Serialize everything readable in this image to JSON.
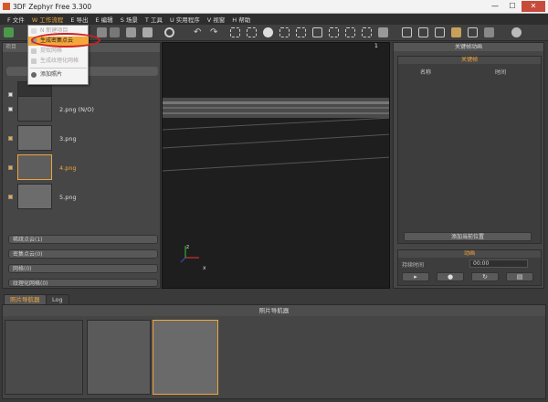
{
  "window": {
    "title": "3DF Zephyr Free 3.300",
    "min": "—",
    "max": "☐",
    "close": "✕"
  },
  "menu": [
    {
      "label": "F 文件"
    },
    {
      "label": "W 工作流程"
    },
    {
      "label": "E 导出"
    },
    {
      "label": "E 编辑"
    },
    {
      "label": "S 场景"
    },
    {
      "label": "T 工具"
    },
    {
      "label": "U 实用程序"
    },
    {
      "label": "V 视窗"
    },
    {
      "label": "H 帮助"
    }
  ],
  "dropdown": {
    "items": [
      {
        "label": "N 新建项目",
        "state": "dim"
      },
      {
        "label": "生成密集点云",
        "state": "highlighted"
      },
      {
        "label": "提取网格",
        "state": "dim"
      },
      {
        "label": "生成纹理化网格",
        "state": "dim"
      },
      {
        "label": "添加照片",
        "state": "normal"
      }
    ]
  },
  "left_panel": {
    "header": "项目",
    "images": [
      {
        "name": "",
        "checked": false,
        "selected": false
      },
      {
        "name": "2.png (N/O)",
        "checked": false,
        "selected": false
      },
      {
        "name": "3.png",
        "checked": true,
        "selected": false
      },
      {
        "name": "4.png",
        "checked": true,
        "selected": true
      },
      {
        "name": "5.png",
        "checked": true,
        "selected": false
      }
    ],
    "sections": [
      "稀疏点云(1)",
      "密集点云(0)",
      "网格(0)",
      "纹理化网格(0)"
    ]
  },
  "viewport": {
    "axis_z": "z",
    "axis_x": "x",
    "marker": "1"
  },
  "right_panel": {
    "title": "关键帧动画",
    "keyframes_header": "关键帧",
    "col_name": "名称",
    "col_time": "时间",
    "add_button": "添加当前位置",
    "anim_header": "动画",
    "duration_label": "持续时间",
    "duration_value": "00:00"
  },
  "bottom": {
    "tabs": [
      "照片导航器",
      "Log"
    ],
    "active_tab": "照片导航器",
    "nav_title": "照片导航器"
  },
  "colors": {
    "accent": "#f0a53a",
    "highlight_ring": "#d42020"
  }
}
